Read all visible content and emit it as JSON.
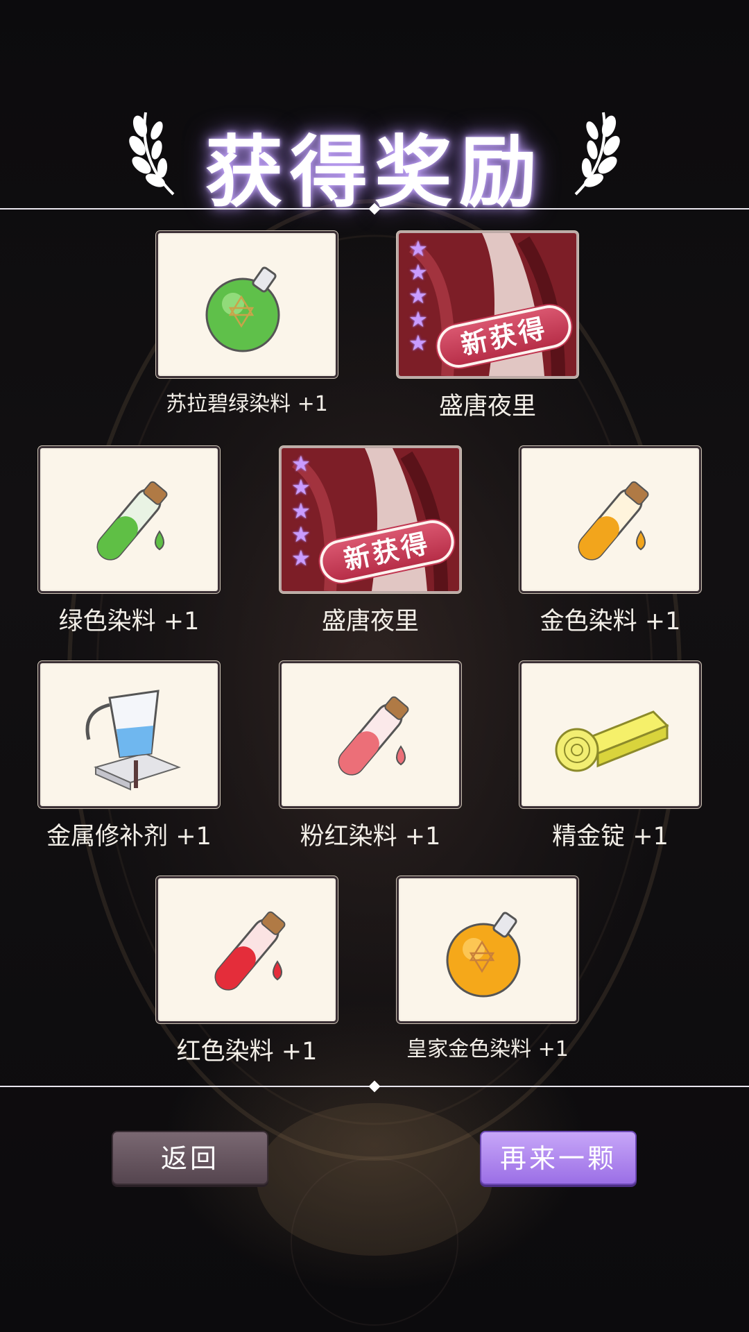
{
  "title": "获得奖励",
  "rewards": [
    {
      "label": "苏拉碧绿染料 +1",
      "icon": "green-potion-flask-icon",
      "new": false
    },
    {
      "label": "盛唐夜里",
      "icon": "costume-portrait-icon",
      "new": true,
      "stars": "★★★★★",
      "badge": "新获得"
    },
    {
      "label": "绿色染料 +1",
      "icon": "green-dye-tube-icon",
      "new": false
    },
    {
      "label": "盛唐夜里",
      "icon": "costume-portrait-icon",
      "new": true,
      "stars": "★★★★★",
      "badge": "新获得"
    },
    {
      "label": "金色染料 +1",
      "icon": "gold-dye-tube-icon",
      "new": false
    },
    {
      "label": "金属修补剂 +1",
      "icon": "metal-repair-pitcher-icon",
      "new": false
    },
    {
      "label": "粉红染料 +1",
      "icon": "pink-dye-tube-icon",
      "new": false
    },
    {
      "label": "精金锭 +1",
      "icon": "gold-ingot-rose-icon",
      "new": false
    },
    {
      "label": "红色染料 +1",
      "icon": "red-dye-tube-icon",
      "new": false
    },
    {
      "label": "皇家金色染料 +1",
      "icon": "royal-gold-potion-flask-icon",
      "new": false
    }
  ],
  "buttons": {
    "back_label": "返回",
    "again_label": "再来一颗"
  },
  "colors": {
    "card_bg": "#fbf5ea",
    "costume_bg": "#6e1a22",
    "back_button": "#6b5a64",
    "again_button": "#b48cf2",
    "title_glow": "#c8aaff",
    "star": "#c99cff"
  }
}
